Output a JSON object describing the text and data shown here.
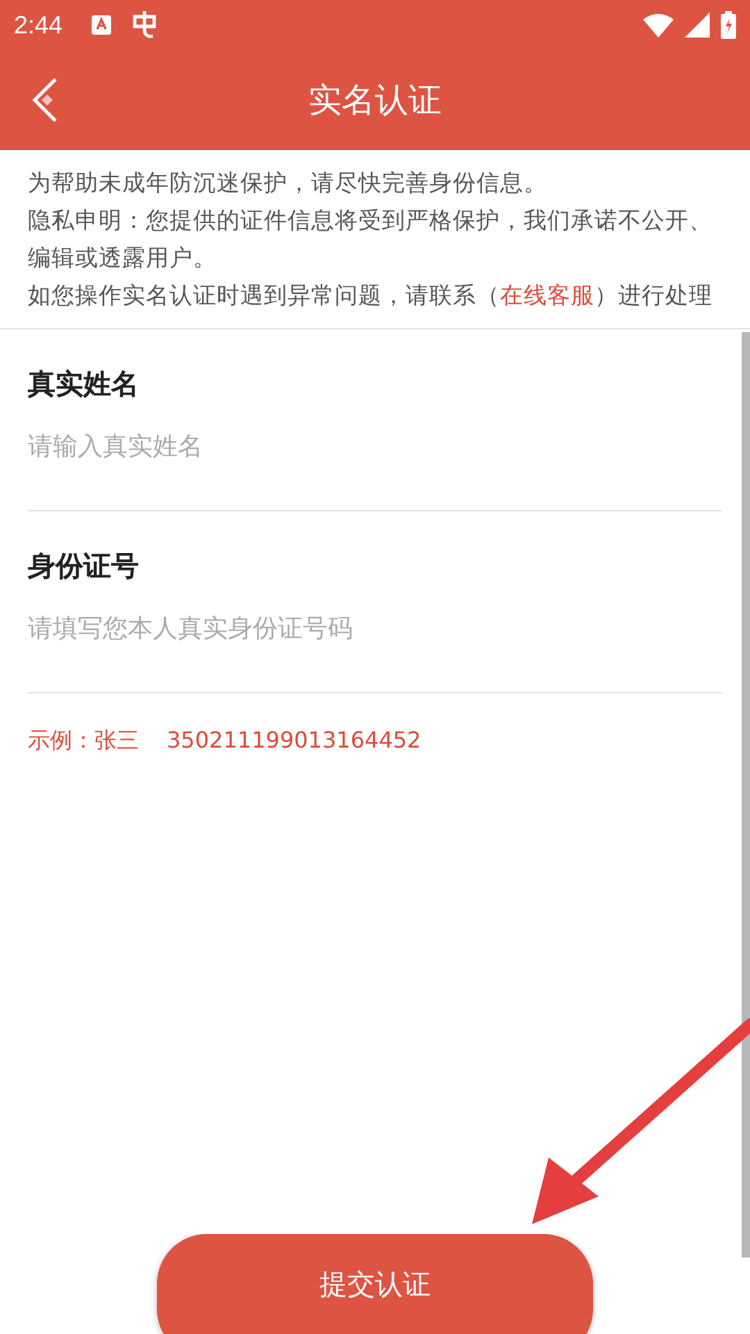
{
  "status_bar": {
    "time": "2:44"
  },
  "header": {
    "title": "实名认证"
  },
  "notice": {
    "lines": [
      "为帮助未成年防沉迷保护，请尽快完善身份信息。",
      "隐私申明：您提供的证件信息将受到严格保护，我们承诺不公开、编辑或透露用户。"
    ],
    "contact": {
      "before": "如您操作实名认证时遇到异常问题，请联系（",
      "link": "在线客服",
      "after": "）进行处理"
    }
  },
  "fields": [
    {
      "label": "真实姓名",
      "placeholder": "请输入真实姓名"
    },
    {
      "label": "身份证号",
      "placeholder": "请填写您本人真实身份证号码"
    }
  ],
  "example": {
    "label": "示例：张三",
    "number": "350211199013164452"
  },
  "submit_button": "提交认证"
}
